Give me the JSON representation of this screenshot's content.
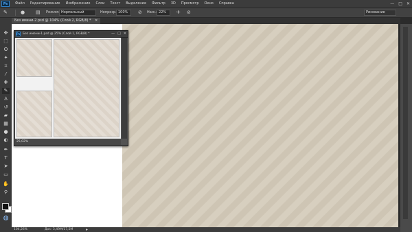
{
  "app": {
    "logo": "Ps"
  },
  "menu": [
    "Файл",
    "Редактирование",
    "Изображение",
    "Слои",
    "Текст",
    "Выделение",
    "Фильтр",
    "3D",
    "Просмотр",
    "Окно",
    "Справка"
  ],
  "window_controls": [
    "—",
    "□",
    "✕"
  ],
  "options": {
    "mode_label": "Режим:",
    "mode_value": "Нормальный",
    "opacity_label": "Непрозр.:",
    "opacity_value": "100%",
    "flow_label": "Наж.:",
    "flow_value": "22%",
    "workspace_value": "Рисование"
  },
  "tab": {
    "title": "Без имени-2.psd @ 104% (Слой 2, RGB/8) *",
    "close": "✕"
  },
  "status": {
    "zoom": "104,26%",
    "doc": "Док: 3,49М/17,5М"
  },
  "ref_window": {
    "title": "Без имени-1.psd @ 25% (Слой 1, RGB/8) *",
    "zoom": "25,02%"
  },
  "colors": {
    "canvas_bg": "#d7cfbf",
    "ui_dark": "#2b2b2b",
    "ps_blue": "#2f7fc6"
  },
  "icons": {
    "tools": [
      "move-icon",
      "marquee-icon",
      "lasso-icon",
      "quick-select-icon",
      "crop-icon",
      "eyedropper-icon",
      "healing-icon",
      "brush-icon",
      "clone-stamp-icon",
      "history-brush-icon",
      "eraser-icon",
      "gradient-icon",
      "blur-icon",
      "dodge-icon",
      "pen-icon",
      "type-icon",
      "path-select-icon",
      "shape-icon",
      "hand-icon",
      "zoom-icon"
    ]
  }
}
